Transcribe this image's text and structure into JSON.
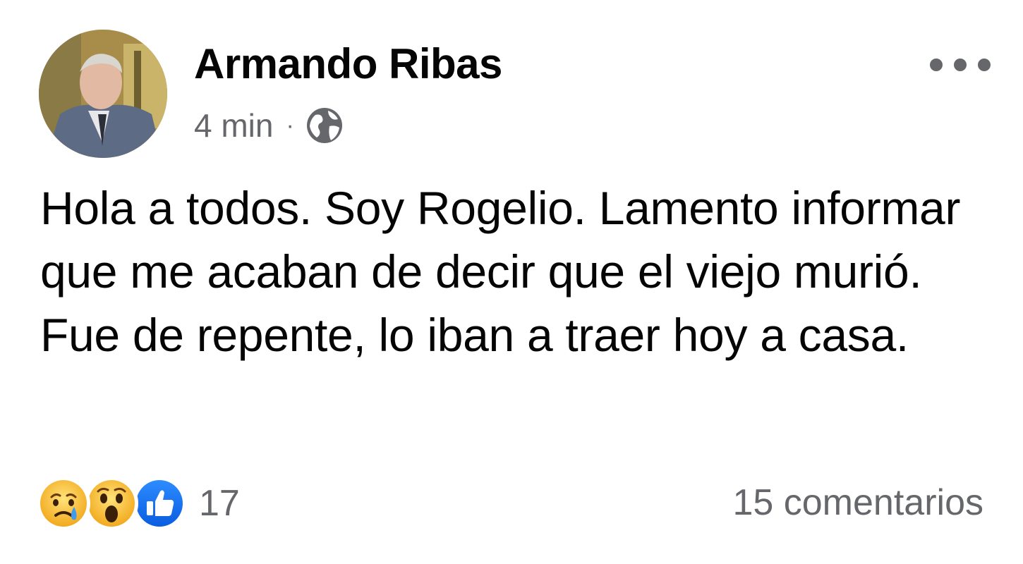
{
  "post": {
    "author": "Armando Ribas",
    "timestamp": "4 min",
    "separator": "·",
    "privacy_icon": "globe-icon",
    "body": "Hola a todos. Soy Rogelio. Lamento informar que me acaban de decir que el viejo murió. Fue de repente, lo iban a traer hoy a casa.",
    "more_icon": "more-options-icon"
  },
  "reactions": {
    "icons": [
      "sad-reaction-icon",
      "wow-reaction-icon",
      "like-reaction-icon"
    ],
    "count": "17",
    "comments": "15 comentarios"
  },
  "colors": {
    "text_primary": "#050505",
    "text_secondary": "#65676b",
    "like_blue": "#1877f2",
    "emoji_yellow": "#f7b125"
  }
}
